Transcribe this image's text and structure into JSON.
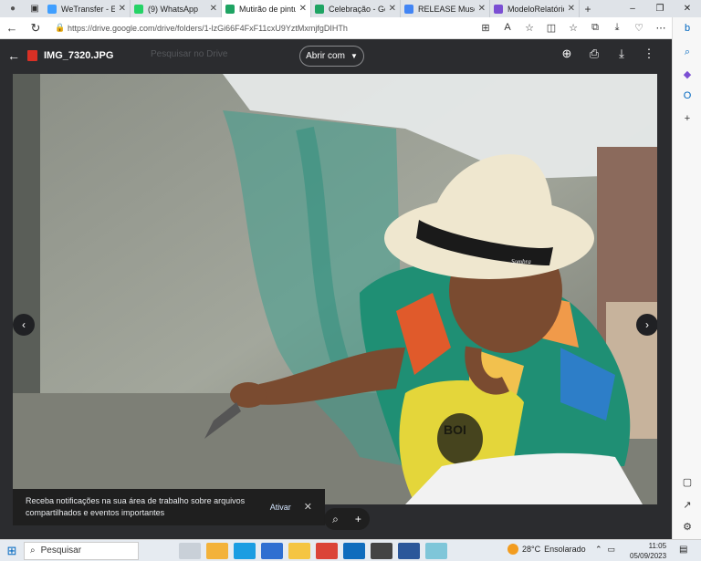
{
  "browser": {
    "tabs": [
      {
        "title": "WeTransfer - Envie",
        "color": "#409fff",
        "active": false
      },
      {
        "title": "(9) WhatsApp",
        "color": "#25d366",
        "active": false
      },
      {
        "title": "Mutirão de pintura",
        "color": "#1fa463",
        "active": true
      },
      {
        "title": "Celebração - Goog",
        "color": "#1fa463",
        "active": false
      },
      {
        "title": "RELEASE Museu d",
        "color": "#4285f4",
        "active": false
      },
      {
        "title": "ModeloRelatório_",
        "color": "#7b4fd3",
        "active": false
      }
    ],
    "url": "https://drive.google.com/drive/folders/1-lzGi66F4FxF11cxU9YztMxmjfgDIHTh"
  },
  "viewer": {
    "file_name": "IMG_7320.JPG",
    "search_placeholder": "Pesquisar no Drive",
    "open_with": "Abrir com",
    "hat_brand": "Sombra",
    "shirt_text": "BOI"
  },
  "toast": {
    "message": "Receba notificações na sua área de trabalho sobre arquivos compartilhados e eventos importantes",
    "action": "Ativar"
  },
  "taskbar": {
    "search": "Pesquisar",
    "temperature": "28°C",
    "condition": "Ensolarado",
    "time": "11:05",
    "date": "05/09/2023"
  },
  "colors": {
    "accent": "#0067c0",
    "viewer_bg": "#2b2c2f"
  }
}
